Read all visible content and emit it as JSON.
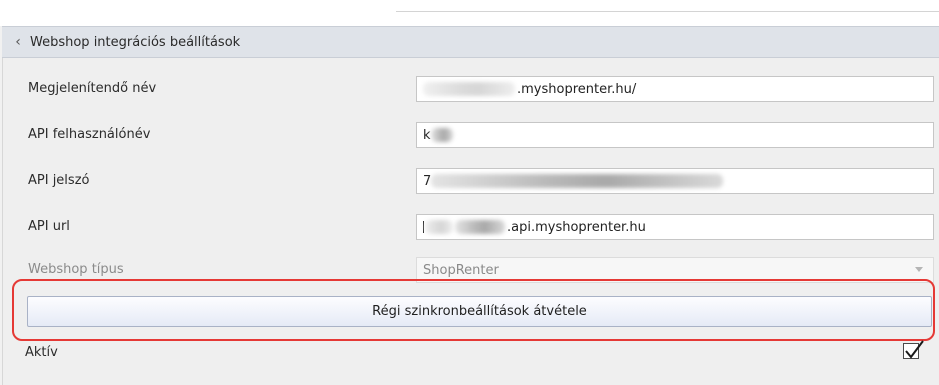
{
  "group": {
    "title": "Webshop integrációs beállítások",
    "collapse_icon": "chevron-left-icon"
  },
  "fields": [
    {
      "label": "Megjelenítendő név",
      "value_suffix": ".myshoprenter.hu/"
    },
    {
      "label": "API felhasználónév",
      "value_prefix": "k"
    },
    {
      "label": "API jelszó",
      "value_prefix": "7"
    },
    {
      "label": "API url",
      "value_suffix": ".api.myshoprenter.hu"
    },
    {
      "label": "Webshop típus",
      "value": "ShopRenter",
      "disabled": true
    }
  ],
  "action_button": {
    "label": "Régi szinkronbeállítások átvétele",
    "highlight_color": "#e53935"
  },
  "active": {
    "label": "Aktív",
    "checked": true
  }
}
